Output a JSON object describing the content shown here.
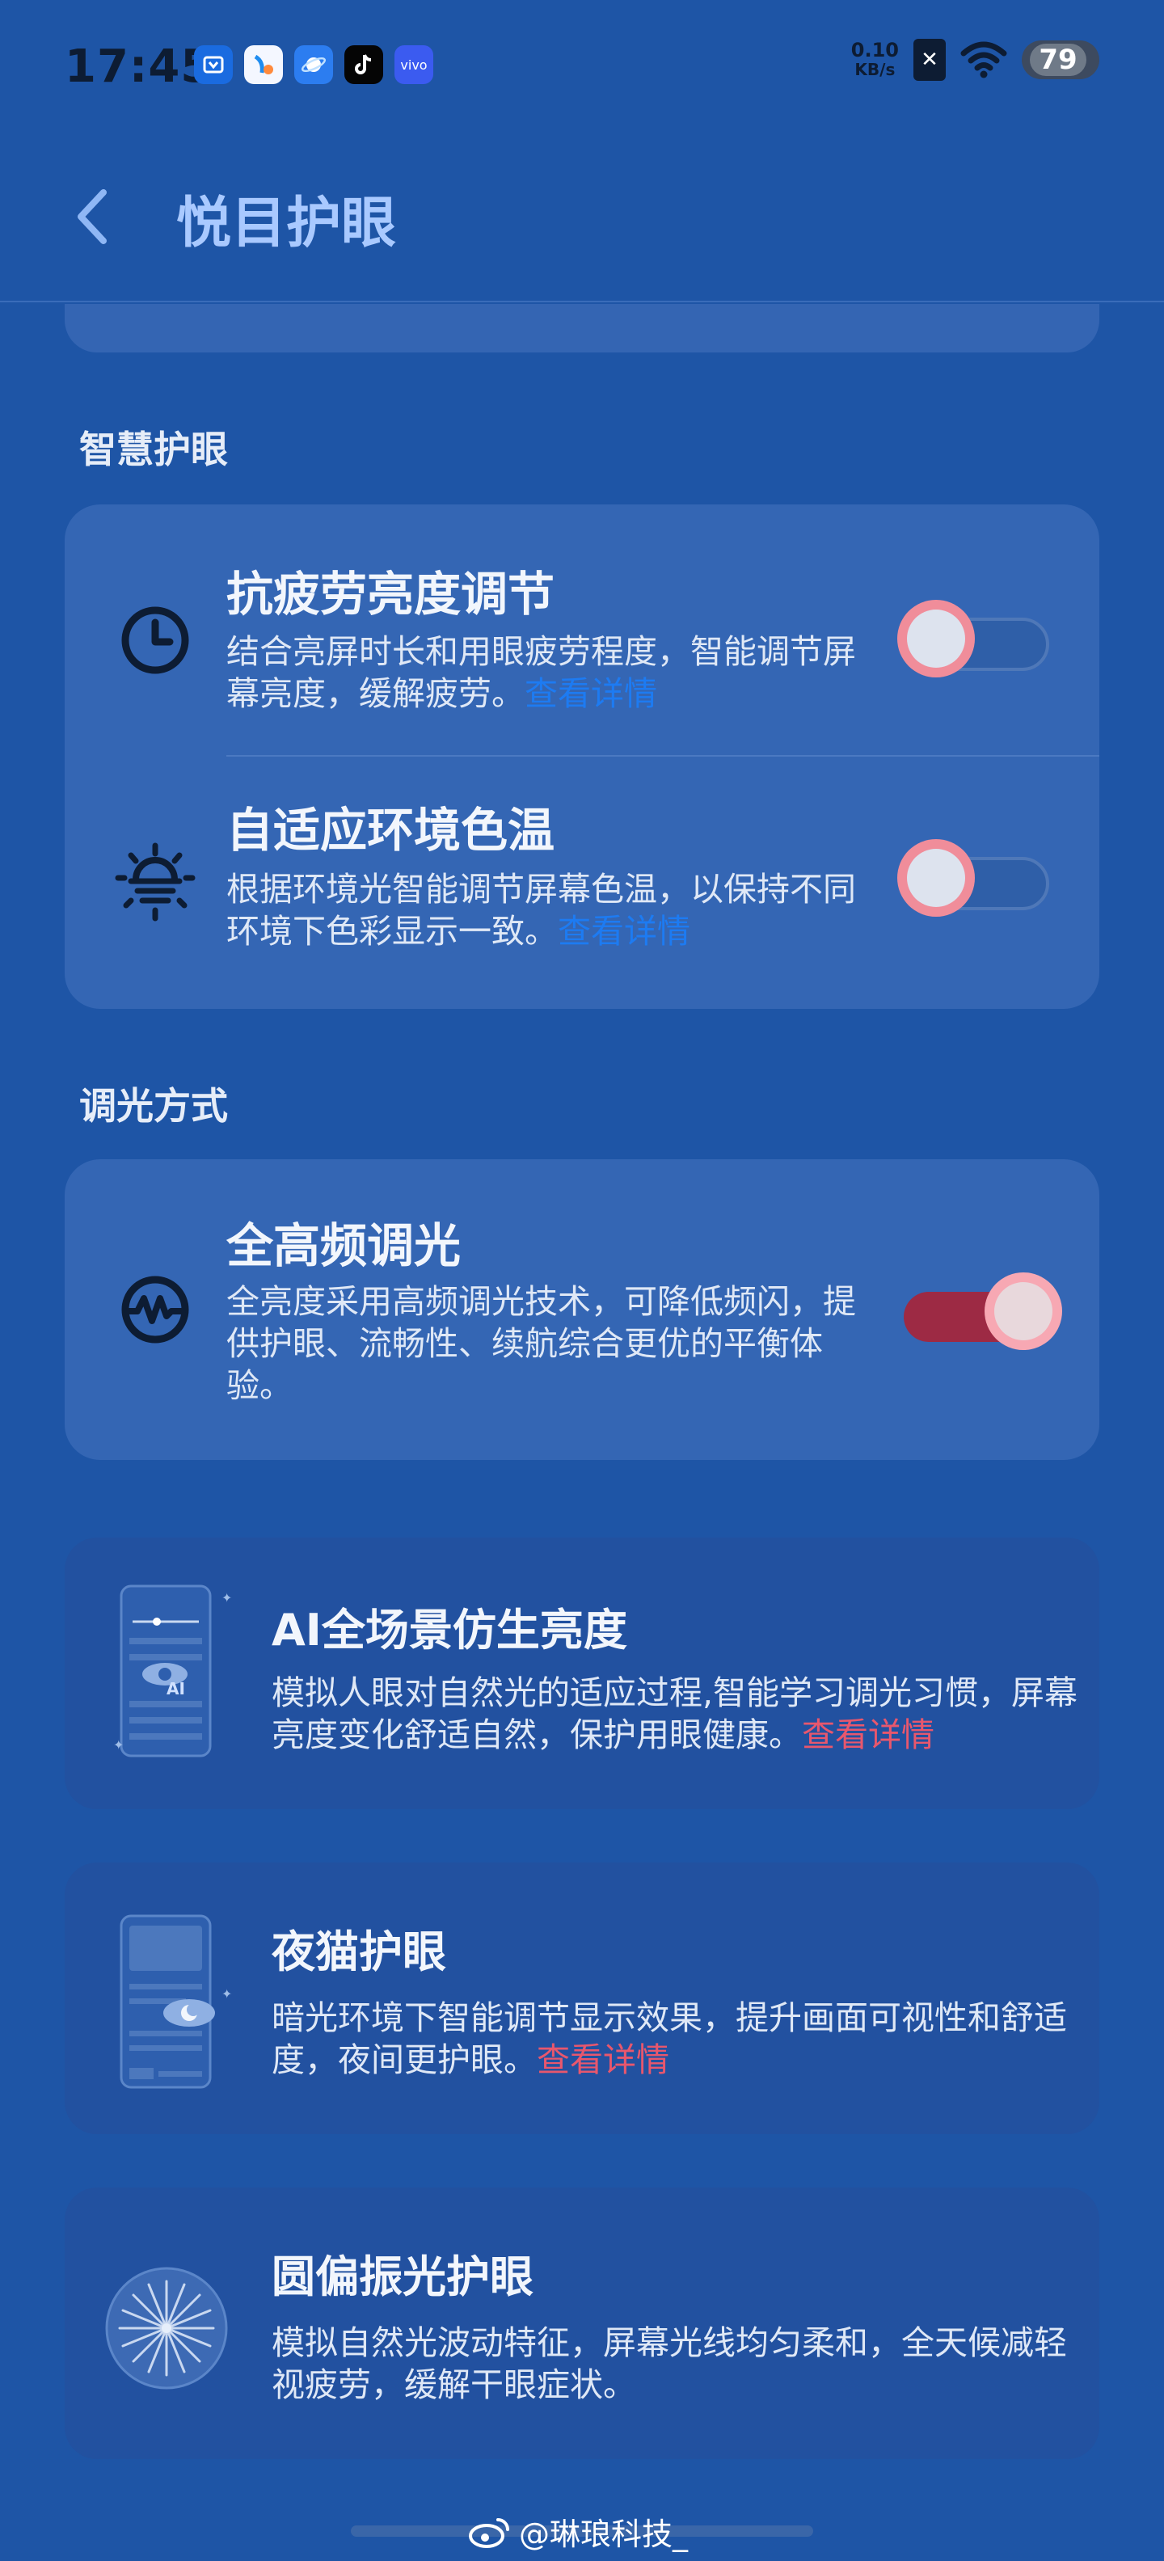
{
  "status_bar": {
    "time": "17:45",
    "apps": [
      "shopping-app-icon",
      "browser-app-icon",
      "planet-app-icon",
      "tiktok-app-icon",
      "vivo-app-icon"
    ],
    "vivo_label": "vivo",
    "speed_value": "0.10",
    "speed_unit": "KB/s",
    "battery": "79"
  },
  "header": {
    "title": "悦目护眼"
  },
  "smart_section": {
    "title": "智慧护眼",
    "items": [
      {
        "title": "抗疲劳亮度调节",
        "desc": "结合亮屏时长和用眼疲劳程度，智能调节屏幕亮度，缓解疲劳。",
        "link": "查看详情",
        "toggle_on": false,
        "icon": "clock-icon"
      },
      {
        "title": "自适应环境色温",
        "desc": "根据环境光智能调节屏幕色温，以保持不同环境下色彩显示一致。",
        "link": "查看详情",
        "toggle_on": false,
        "icon": "sun-temperature-icon"
      }
    ]
  },
  "dimming_section": {
    "title": "调光方式",
    "item": {
      "title": "全高频调光",
      "desc": "全亮度采用高频调光技术，可降低频闪，提供护眼、流畅性、续航综合更优的平衡体验。",
      "toggle_on": true,
      "icon": "wave-circle-icon"
    }
  },
  "features": [
    {
      "title": "AI全场景仿生亮度",
      "desc": "模拟人眼对自然光的适应过程,智能学习调光习惯，屏幕亮度变化舒适自然，保护用眼健康。",
      "link": "查看详情",
      "illustration": "phone-ai-eye-illustration",
      "badge": "AI"
    },
    {
      "title": "夜猫护眼",
      "desc": "暗光环境下智能调节显示效果，提升画面可视性和舒适度，夜间更护眼。",
      "link": "查看详情",
      "illustration": "phone-night-eye-illustration"
    },
    {
      "title": "圆偏振光护眼",
      "desc": "模拟自然光波动特征，屏幕光线均匀柔和，全天候减轻视疲劳，缓解干眼症状。",
      "link": "",
      "illustration": "polarized-light-illustration"
    }
  ],
  "watermark": "@琳琅科技_",
  "colors": {
    "accent_blue": "#1d7bf2",
    "accent_red": "#e8576d",
    "toggle_on": "#9d2a44",
    "background": "#1e55a6"
  }
}
